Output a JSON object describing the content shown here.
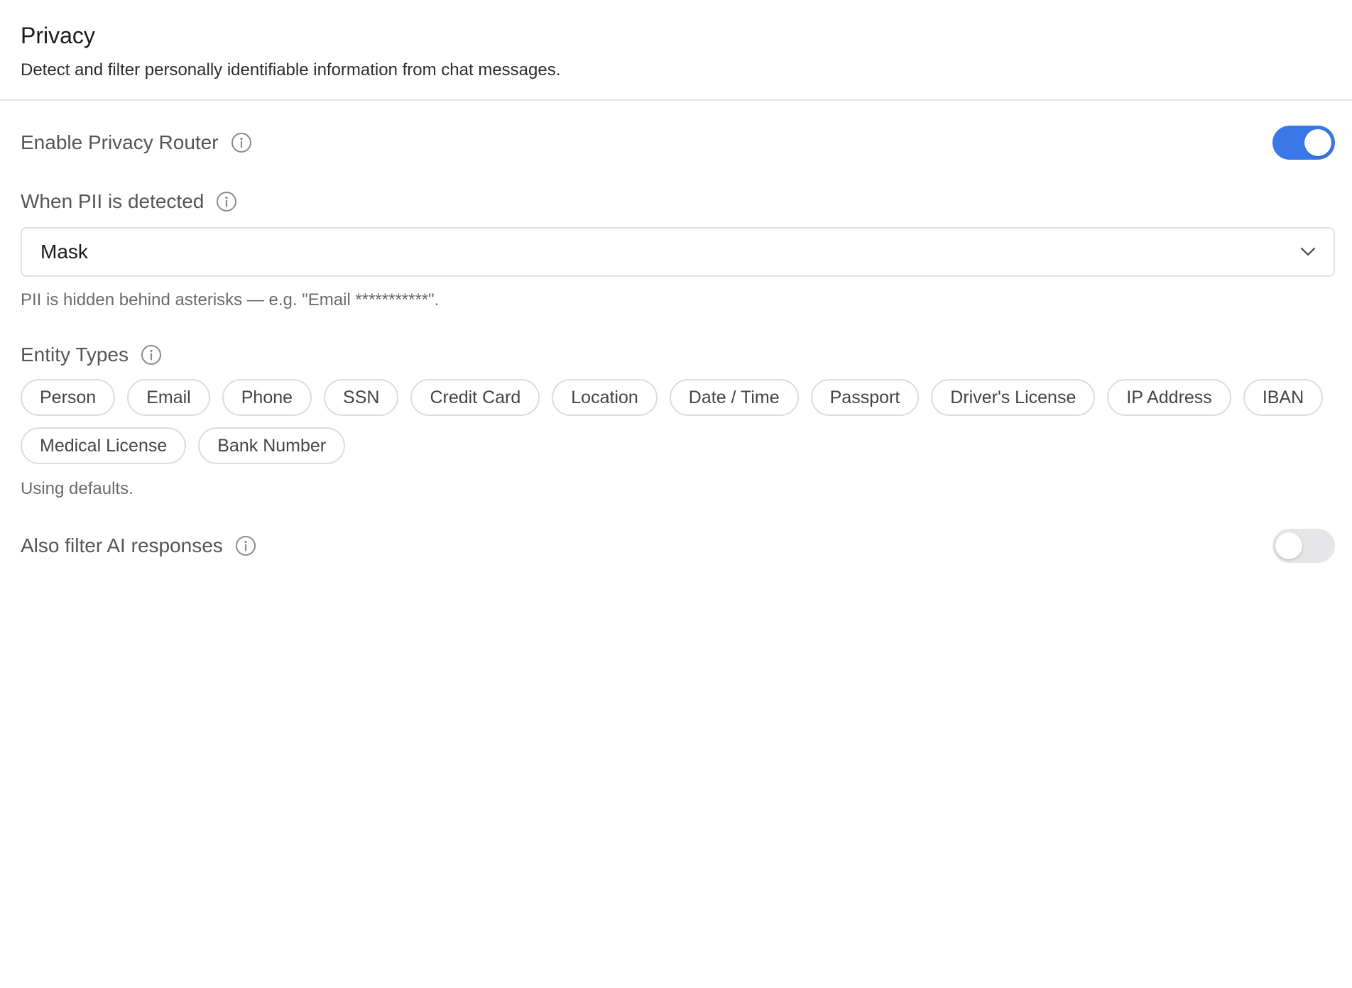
{
  "header": {
    "title": "Privacy",
    "subtitle": "Detect and filter personally identifiable information from chat messages."
  },
  "enable_router": {
    "label": "Enable Privacy Router",
    "enabled": true
  },
  "pii_action": {
    "label": "When PII is detected",
    "selected": "Mask",
    "hint": "PII is hidden behind asterisks — e.g. \"Email ***********\"."
  },
  "entity_types": {
    "label": "Entity Types",
    "chips": [
      "Person",
      "Email",
      "Phone",
      "SSN",
      "Credit Card",
      "Location",
      "Date / Time",
      "Passport",
      "Driver's License",
      "IP Address",
      "IBAN",
      "Medical License",
      "Bank Number"
    ],
    "note": "Using defaults."
  },
  "filter_ai": {
    "label": "Also filter AI responses",
    "enabled": false
  },
  "colors": {
    "accent": "#3b78e7",
    "toggle_off": "#e6e6e8",
    "label": "#555555",
    "hint": "#6b6b6b",
    "border": "#e2e2e2"
  },
  "icons": {
    "info": "info-circle-icon",
    "chevron": "chevron-down-icon"
  }
}
